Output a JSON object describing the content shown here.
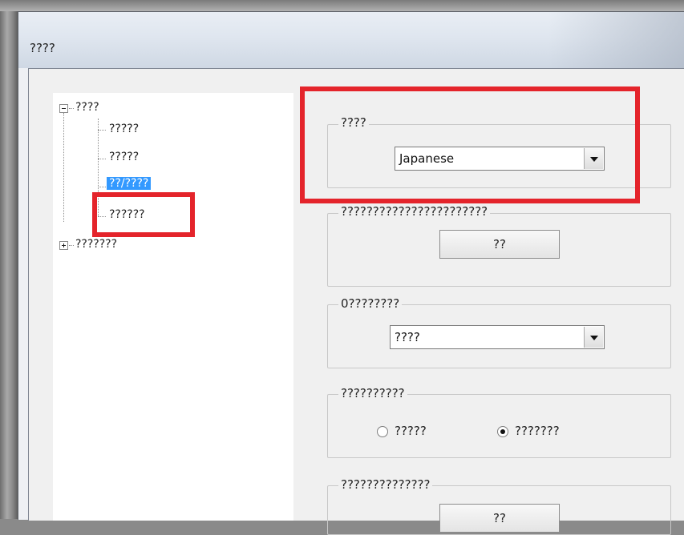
{
  "window": {
    "title": "????"
  },
  "tree": {
    "root_label": "????",
    "children": [
      "?????",
      "?????",
      "??/????",
      "??????"
    ],
    "selected_index": 2,
    "second_root_label": "???????"
  },
  "groups": {
    "language": {
      "legend": "????",
      "selected_value": "Japanese"
    },
    "group2": {
      "legend": "???????????????????????",
      "button_label": "??"
    },
    "group3": {
      "legend": "0????????",
      "selected_value": "????"
    },
    "group4": {
      "legend": "??????????",
      "options": [
        "?????",
        "???????"
      ],
      "selected_index": 1
    },
    "group5": {
      "legend": "??????????????",
      "button_label": "??"
    }
  },
  "annotations": {
    "highlight_color": "#e4242b"
  },
  "colors": {
    "selection_blue": "#3399ff"
  }
}
